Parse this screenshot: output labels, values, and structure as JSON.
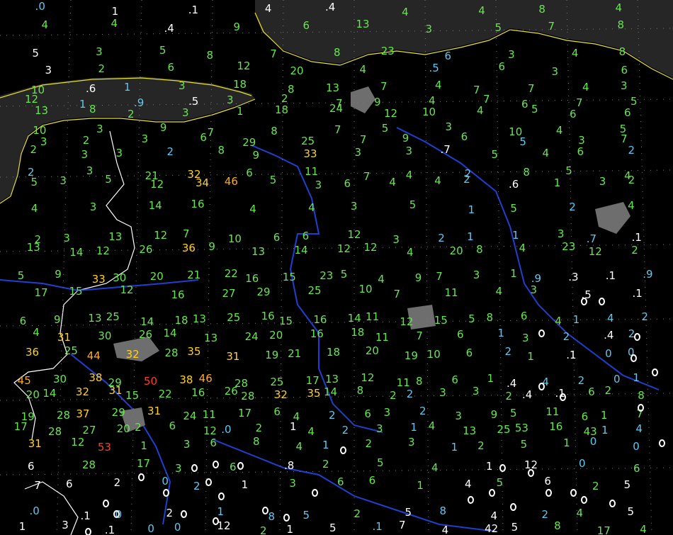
{
  "colors": {
    "background": "#000000",
    "land_outside": "#262626",
    "coastline": "#e8e02a",
    "border": "#ffffff",
    "river": "#1f3fd0",
    "urban": "#6e6e6e",
    "grid": "#7a7a7a",
    "green": "#66e64d",
    "cyan": "#5fc8f0",
    "white": "#ffffff",
    "yellow": "#ffd21e",
    "orange": "#ffaa1e",
    "red": "#ff3c28"
  },
  "icons": [
    "station-value",
    "snow-depth-zero-ring",
    "boxed-station-value"
  ],
  "rows": [
    [
      [
        ".0",
        "c"
      ],
      [
        "1",
        "w"
      ],
      [
        ".1",
        "w"
      ],
      [
        "4",
        "w"
      ],
      [
        ".4",
        "w"
      ],
      [
        "4",
        "g"
      ],
      [
        "4",
        "g"
      ],
      [
        "8",
        "g"
      ],
      [
        "4",
        "g"
      ]
    ],
    [
      [
        "4",
        "g"
      ],
      [
        "4",
        "g"
      ],
      [
        ".4",
        "w"
      ],
      [
        "9",
        "g"
      ],
      [
        "6",
        "g"
      ],
      [
        "13",
        "g"
      ],
      [
        "3",
        "g"
      ],
      [
        "5",
        "g"
      ],
      [
        "7",
        "g"
      ],
      [
        "8",
        "g"
      ]
    ],
    [
      [
        "5",
        "w"
      ],
      [
        "3",
        "g"
      ],
      [
        "5",
        "g"
      ],
      [
        "8",
        "g"
      ],
      [
        "7",
        "g"
      ],
      [
        "8",
        "g"
      ],
      [
        "23",
        "g"
      ],
      [
        "6",
        "c"
      ],
      [
        "3",
        "g"
      ],
      [
        "4",
        "g"
      ],
      [
        "8",
        "g"
      ]
    ],
    [
      [
        "3",
        "w"
      ],
      [
        "2",
        "g"
      ],
      [
        "6",
        "g"
      ],
      [
        "12",
        "g"
      ],
      [
        "20",
        "g"
      ],
      [
        "4",
        "g"
      ],
      [
        ".5",
        "c"
      ],
      [
        "6",
        "g"
      ],
      [
        "3",
        "g"
      ],
      [
        "6",
        "g"
      ]
    ],
    [
      [
        "10",
        "g"
      ],
      [
        ".6",
        "w"
      ],
      [
        "1",
        "c"
      ],
      [
        "3",
        "g"
      ],
      [
        "18",
        "g"
      ],
      [
        "8",
        "g"
      ],
      [
        "13",
        "g"
      ],
      [
        "7",
        "g"
      ],
      [
        "4",
        "g"
      ],
      [
        "7",
        "g"
      ],
      [
        "7",
        "g"
      ],
      [
        "4",
        "g"
      ],
      [
        "3",
        "g"
      ]
    ],
    [
      [
        "12",
        "g"
      ],
      [
        "1",
        "c"
      ],
      [
        ".9",
        "c"
      ],
      [
        ".5",
        "w"
      ],
      [
        "3",
        "g"
      ],
      [
        "2",
        "g"
      ],
      [
        "7",
        "g"
      ],
      [
        "9",
        "g"
      ],
      [
        "4",
        "g"
      ],
      [
        "7",
        "g"
      ],
      [
        "6",
        "g"
      ],
      [
        "7",
        "g"
      ],
      [
        "5",
        "g"
      ]
    ],
    [
      [
        "13",
        "g"
      ],
      [
        "8",
        "g"
      ],
      [
        "2",
        "g"
      ],
      [
        "3",
        "g"
      ],
      [
        "1",
        "g"
      ],
      [
        "18",
        "g"
      ],
      [
        "24",
        "g"
      ],
      [
        "12",
        "g"
      ],
      [
        "10",
        "g"
      ],
      [
        "4",
        "g"
      ],
      [
        "5",
        "g"
      ],
      [
        "6",
        "g"
      ],
      [
        "6",
        "g"
      ]
    ],
    [
      [
        "10",
        "g"
      ],
      [
        "3",
        "g"
      ],
      [
        "9",
        "g"
      ],
      [
        "7",
        "g"
      ],
      [
        "8",
        "g"
      ],
      [
        "7",
        "g"
      ],
      [
        "5",
        "g"
      ],
      [
        "3",
        "g"
      ],
      [
        "10",
        "g"
      ],
      [
        "4",
        "g"
      ],
      [
        "5",
        "g"
      ]
    ],
    [
      [
        "3",
        "g"
      ],
      [
        "2",
        "g"
      ],
      [
        "3",
        "g"
      ],
      [
        "6",
        "g"
      ],
      [
        "29",
        "g"
      ],
      [
        "25",
        "g"
      ],
      [
        "7",
        "g"
      ],
      [
        "9",
        "g"
      ],
      [
        "6",
        "g"
      ],
      [
        "5",
        "c"
      ],
      [
        "3",
        "g"
      ],
      [
        "7",
        "g"
      ]
    ],
    [
      [
        "2",
        "g"
      ],
      [
        "3",
        "g"
      ],
      [
        "3",
        "g"
      ],
      [
        "2",
        "c"
      ],
      [
        "8",
        "g"
      ],
      [
        "9",
        "g"
      ],
      [
        "33",
        "y"
      ],
      [
        "3",
        "g"
      ],
      [
        "3",
        "g"
      ],
      [
        ".7",
        "w"
      ],
      [
        "5",
        "g"
      ],
      [
        "4",
        "g"
      ],
      [
        "6",
        "g"
      ],
      [
        "2",
        "c"
      ]
    ],
    [
      [
        "2",
        "c"
      ],
      [
        "3",
        "g"
      ],
      [
        "21",
        "g"
      ],
      [
        "32",
        "y"
      ],
      [
        "6",
        "g"
      ],
      [
        "11",
        "g"
      ],
      [
        "7",
        "g"
      ],
      [
        "4",
        "g"
      ],
      [
        "2",
        "c"
      ],
      [
        "8",
        "g"
      ],
      [
        "5",
        "g"
      ],
      [
        "4",
        "g"
      ]
    ],
    [
      [
        "5",
        "g"
      ],
      [
        "3",
        "g"
      ],
      [
        "5",
        "g"
      ],
      [
        "12",
        "g"
      ],
      [
        "34",
        "y"
      ],
      [
        "46",
        "o"
      ],
      [
        "5",
        "g"
      ],
      [
        "3",
        "g"
      ],
      [
        "6",
        "g"
      ],
      [
        "4",
        "g"
      ],
      [
        "4",
        "g"
      ],
      [
        "2",
        "c"
      ],
      [
        ".6",
        "w"
      ],
      [
        "1",
        "g"
      ],
      [
        "3",
        "g"
      ],
      [
        "2",
        "g"
      ]
    ],
    [
      [
        "4",
        "g"
      ],
      [
        "3",
        "g"
      ],
      [
        "14",
        "g"
      ],
      [
        "16",
        "g"
      ],
      [
        "4",
        "g"
      ],
      [
        "4",
        "g"
      ],
      [
        "3",
        "g"
      ],
      [
        "5",
        "g"
      ],
      [
        "1",
        "c"
      ],
      [
        "5",
        "g"
      ],
      [
        "2",
        "c"
      ],
      [
        "4",
        "g"
      ]
    ],
    [
      [
        "2",
        "g"
      ],
      [
        "3",
        "g"
      ],
      [
        "13",
        "g"
      ],
      [
        "12",
        "g"
      ],
      [
        "7",
        "g"
      ],
      [
        "10",
        "g"
      ],
      [
        "6",
        "g"
      ],
      [
        "6",
        "g"
      ],
      [
        "12",
        "g"
      ],
      [
        "3",
        "g"
      ],
      [
        "2",
        "c"
      ],
      [
        "1",
        "c"
      ],
      [
        "1",
        "c"
      ],
      [
        "3",
        "g"
      ],
      [
        ".7",
        "c"
      ],
      [
        ".1",
        "w"
      ]
    ],
    [
      [
        "13",
        "g"
      ],
      [
        "14",
        "g"
      ],
      [
        "12",
        "g"
      ],
      [
        "26",
        "g"
      ],
      [
        "36",
        "y"
      ],
      [
        "9",
        "g"
      ],
      [
        "13",
        "g"
      ],
      [
        "14",
        "g"
      ],
      [
        "12",
        "g"
      ],
      [
        "12",
        "g"
      ],
      [
        "4",
        "g"
      ],
      [
        "20",
        "g"
      ],
      [
        "8",
        "g"
      ],
      [
        "4",
        "g"
      ],
      [
        "23",
        "g"
      ],
      [
        "12",
        "g"
      ],
      [
        "2",
        "g"
      ]
    ],
    [
      [
        "5",
        "g"
      ],
      [
        "9",
        "g"
      ],
      [
        "33",
        "y"
      ],
      [
        "30",
        "g"
      ],
      [
        "20",
        "g"
      ],
      [
        "21",
        "g"
      ],
      [
        "22",
        "g"
      ],
      [
        "16",
        "g"
      ],
      [
        "15",
        "g"
      ],
      [
        "23",
        "g"
      ],
      [
        "5",
        "g"
      ],
      [
        "4",
        "g"
      ],
      [
        "9",
        "g"
      ],
      [
        "7",
        "g"
      ],
      [
        "3",
        "g"
      ],
      [
        "1",
        "g"
      ],
      [
        ".9",
        "c"
      ],
      [
        ".3",
        "w"
      ],
      [
        ".1",
        "w"
      ],
      [
        ".9",
        "c"
      ]
    ],
    [
      [
        "17",
        "g"
      ],
      [
        "15",
        "g"
      ],
      [
        "12",
        "g"
      ],
      [
        "16",
        "g"
      ],
      [
        "27",
        "g"
      ],
      [
        "29",
        "g"
      ],
      [
        "25",
        "g"
      ],
      [
        "10",
        "g"
      ],
      [
        "7",
        "g"
      ],
      [
        "11",
        "g"
      ],
      [
        "4",
        "g"
      ],
      [
        "3",
        "g"
      ],
      [
        ".5",
        "w"
      ],
      [
        ".1",
        "w"
      ]
    ],
    [
      [
        "6",
        "g"
      ],
      [
        "9",
        "g"
      ],
      [
        "13",
        "g"
      ],
      [
        "25",
        "g"
      ],
      [
        "14",
        "g"
      ],
      [
        "18",
        "g"
      ],
      [
        "13",
        "g"
      ],
      [
        "25",
        "g"
      ],
      [
        "16",
        "g"
      ],
      [
        "15",
        "g"
      ],
      [
        "16",
        "g"
      ],
      [
        "14",
        "g"
      ],
      [
        "11",
        "g"
      ],
      [
        "12",
        "g"
      ],
      [
        "15",
        "g"
      ],
      [
        "5",
        "g"
      ],
      [
        "8",
        "g"
      ],
      [
        "6",
        "g"
      ],
      [
        "4",
        "g"
      ],
      [
        "1",
        "c"
      ],
      [
        "4",
        "c"
      ],
      [
        "2",
        "c"
      ]
    ],
    [
      [
        "4",
        "g"
      ],
      [
        "31",
        "y"
      ],
      [
        "30",
        "g"
      ],
      [
        "26",
        "g"
      ],
      [
        "14",
        "g"
      ],
      [
        "13",
        "g"
      ],
      [
        "24",
        "g"
      ],
      [
        "20",
        "g"
      ],
      [
        "16",
        "g"
      ],
      [
        "18",
        "g"
      ],
      [
        "11",
        "g"
      ],
      [
        "7",
        "g"
      ],
      [
        "6",
        "g"
      ],
      [
        "1",
        "c"
      ],
      [
        "3",
        "g"
      ],
      [
        "2",
        "c"
      ],
      [
        ".4",
        "w"
      ],
      [
        "2",
        "c"
      ]
    ],
    [
      [
        "36",
        "y"
      ],
      [
        "25",
        "g"
      ],
      [
        "44",
        "o"
      ],
      [
        "32",
        "y"
      ],
      [
        "28",
        "g"
      ],
      [
        "35",
        "y"
      ],
      [
        "31",
        "y"
      ],
      [
        "19",
        "g"
      ],
      [
        "21",
        "g"
      ],
      [
        "18",
        "g"
      ],
      [
        "20",
        "g"
      ],
      [
        "19",
        "g"
      ],
      [
        "10",
        "g"
      ],
      [
        "6",
        "g"
      ],
      [
        "2",
        "c"
      ],
      [
        "1",
        "g"
      ],
      [
        ".1",
        "w"
      ],
      [
        "0",
        "c"
      ],
      [
        "0",
        "c"
      ]
    ],
    [
      [
        "45",
        "o"
      ],
      [
        "30",
        "g"
      ],
      [
        "38",
        "y"
      ],
      [
        "29",
        "g"
      ],
      [
        "50",
        "r"
      ],
      [
        "38",
        "y"
      ],
      [
        "46",
        "o"
      ],
      [
        "28",
        "g"
      ],
      [
        "25",
        "g"
      ],
      [
        "17",
        "g"
      ],
      [
        "13",
        "g"
      ],
      [
        "12",
        "g"
      ],
      [
        "11",
        "g"
      ],
      [
        "8",
        "g"
      ],
      [
        "6",
        "g"
      ],
      [
        "1",
        "g"
      ],
      [
        ".4",
        "w"
      ],
      [
        "4",
        "c"
      ],
      [
        "2",
        "c"
      ],
      [
        "0",
        "c"
      ],
      [
        "1",
        "c"
      ]
    ],
    [
      [
        "20",
        "g"
      ],
      [
        "14",
        "g"
      ],
      [
        "32",
        "y"
      ],
      [
        "31",
        "y"
      ],
      [
        "15",
        "g"
      ],
      [
        "22",
        "g"
      ],
      [
        "16",
        "g"
      ],
      [
        "26",
        "g"
      ],
      [
        "28",
        "g"
      ],
      [
        "32",
        "y"
      ],
      [
        "35",
        "y"
      ],
      [
        "14",
        "g"
      ],
      [
        "8",
        "g"
      ],
      [
        "2",
        "g"
      ],
      [
        "2",
        "c"
      ],
      [
        "3",
        "g"
      ],
      [
        "3",
        "g"
      ],
      [
        "2",
        "g"
      ],
      [
        ".4",
        "w"
      ],
      [
        ".1",
        "w"
      ],
      [
        "6",
        "g"
      ],
      [
        "2",
        "g"
      ],
      [
        "8",
        "g"
      ]
    ],
    [
      [
        "19",
        "g"
      ],
      [
        "28",
        "g"
      ],
      [
        "37",
        "y"
      ],
      [
        "29",
        "g"
      ],
      [
        "31",
        "y"
      ],
      [
        "24",
        "g"
      ],
      [
        "11",
        "g"
      ],
      [
        "17",
        "g"
      ],
      [
        "6",
        "g"
      ],
      [
        "4",
        "g"
      ],
      [
        "2",
        "c"
      ],
      [
        "6",
        "g"
      ],
      [
        "3",
        "g"
      ],
      [
        "2",
        "c"
      ],
      [
        "3",
        "g"
      ],
      [
        "9",
        "g"
      ],
      [
        "5",
        "g"
      ],
      [
        "11",
        "g"
      ],
      [
        "6",
        "g"
      ],
      [
        "1",
        "g"
      ],
      [
        "7",
        "g"
      ]
    ],
    [
      [
        "17",
        "g"
      ],
      [
        "28",
        "g"
      ],
      [
        "27",
        "g"
      ],
      [
        "20",
        "g"
      ],
      [
        "2",
        "g"
      ],
      [
        "6",
        "g"
      ],
      [
        "12",
        "g"
      ],
      [
        ".0",
        "c"
      ],
      [
        "2",
        "g"
      ],
      [
        "1",
        "w"
      ],
      [
        "4",
        "g"
      ],
      [
        "2",
        "c"
      ],
      [
        "3",
        "g"
      ],
      [
        "1",
        "c"
      ],
      [
        "4",
        "g"
      ],
      [
        "13",
        "g"
      ],
      [
        "25",
        "g"
      ],
      [
        "53",
        "g"
      ],
      [
        "16",
        "g"
      ],
      [
        "43",
        "g"
      ],
      [
        "1",
        "c"
      ],
      [
        "4",
        "c"
      ]
    ],
    [
      [
        "31",
        "y"
      ],
      [
        "12",
        "g"
      ],
      [
        "53",
        "r"
      ],
      [
        "1",
        "g"
      ],
      [
        "3",
        "g"
      ],
      [
        "6",
        "g"
      ],
      [
        "8",
        "g"
      ],
      [
        "4",
        "g"
      ],
      [
        "1",
        "c"
      ],
      [
        "2",
        "g"
      ],
      [
        "3",
        "g"
      ],
      [
        "1",
        "c"
      ],
      [
        "2",
        "g"
      ],
      [
        "5",
        "g"
      ],
      [
        "1",
        "g"
      ],
      [
        "0",
        "c"
      ],
      [
        "0",
        "c"
      ]
    ],
    [
      [
        "6",
        "w"
      ],
      [
        "28",
        "g"
      ],
      [
        "17",
        "g"
      ],
      [
        "3",
        "g"
      ],
      [
        "6",
        "g"
      ],
      [
        ".8",
        "w"
      ],
      [
        "2",
        "g"
      ],
      [
        "5",
        "g"
      ],
      [
        "4",
        "g"
      ],
      [
        "1",
        "w"
      ],
      [
        "12",
        "w"
      ],
      [
        "0",
        "c"
      ],
      [
        "6",
        "g"
      ]
    ],
    [
      [
        "7",
        "w"
      ],
      [
        "6",
        "w"
      ],
      [
        "2",
        "w"
      ],
      [
        "0",
        "c"
      ],
      [
        "2",
        "c"
      ],
      [
        "1",
        "w"
      ],
      [
        "3",
        "g"
      ],
      [
        "6",
        "g"
      ],
      [
        "6",
        "g"
      ],
      [
        "1",
        "g"
      ],
      [
        "4",
        "w"
      ],
      [
        "5",
        "g"
      ],
      [
        "6",
        "w"
      ],
      [
        "2",
        "g"
      ],
      [
        "5",
        "w"
      ]
    ],
    [
      [
        ".0",
        "c"
      ],
      [
        ".1",
        "w"
      ],
      [
        "0",
        "c"
      ],
      [
        "2",
        "w"
      ],
      [
        "1",
        "c"
      ],
      [
        "8",
        "c"
      ],
      [
        "5",
        "c"
      ],
      [
        "2",
        "g"
      ],
      [
        "5",
        "w"
      ],
      [
        "8",
        "c"
      ],
      [
        "4",
        "w"
      ],
      [
        "2",
        "c"
      ],
      [
        "4",
        "g"
      ],
      [
        "5",
        "w"
      ]
    ],
    [
      [
        "1",
        "w"
      ],
      [
        "3",
        "w"
      ],
      [
        ".1",
        "w"
      ],
      [
        "0",
        "c"
      ],
      [
        "0",
        "c"
      ],
      [
        "12",
        "w"
      ],
      [
        "2",
        "g"
      ],
      [
        "1",
        "w"
      ],
      [
        "5",
        "w"
      ],
      [
        ".1",
        "c"
      ],
      [
        "7",
        "w"
      ],
      [
        "4",
        "w"
      ],
      [
        "42",
        "w"
      ],
      [
        "5",
        "w"
      ],
      [
        "8",
        "g"
      ],
      [
        "17",
        "g"
      ],
      [
        "4",
        "g"
      ]
    ]
  ]
}
